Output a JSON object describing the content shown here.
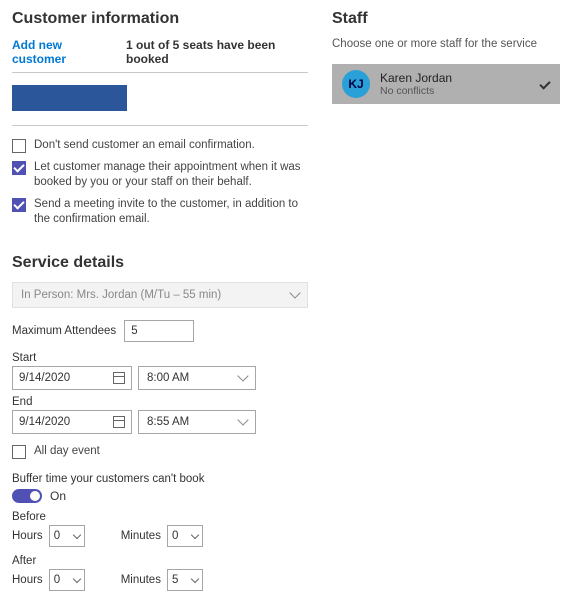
{
  "customer": {
    "heading": "Customer information",
    "add_link": "Add new customer",
    "seats_text": "1 out of 5 seats have been booked",
    "options": {
      "dont_send": "Don't send customer an email confirmation.",
      "let_manage": "Let customer manage their appointment when it was booked by you or your staff on their behalf.",
      "send_meeting": "Send a meeting invite to the customer, in addition to the confirmation email."
    }
  },
  "service": {
    "heading": "Service details",
    "selected": "In Person: Mrs. Jordan (M/Tu – 55 min)",
    "max_label": "Maximum Attendees",
    "max_value": "5",
    "start_label": "Start",
    "start_date": "9/14/2020",
    "start_time": "8:00 AM",
    "end_label": "End",
    "end_date": "9/14/2020",
    "end_time": "8:55 AM",
    "allday_label": "All day event",
    "buffer_label": "Buffer time your customers can't book",
    "toggle_state": "On",
    "before_label": "Before",
    "after_label": "After",
    "hours_label": "Hours",
    "minutes_label": "Minutes",
    "before_hours": "0",
    "before_minutes": "0",
    "after_hours": "0",
    "after_minutes": "5"
  },
  "staff": {
    "heading": "Staff",
    "sub": "Choose one or more staff for the service",
    "member": {
      "initials": "KJ",
      "name": "Karen Jordan",
      "status": "No conflicts"
    }
  }
}
